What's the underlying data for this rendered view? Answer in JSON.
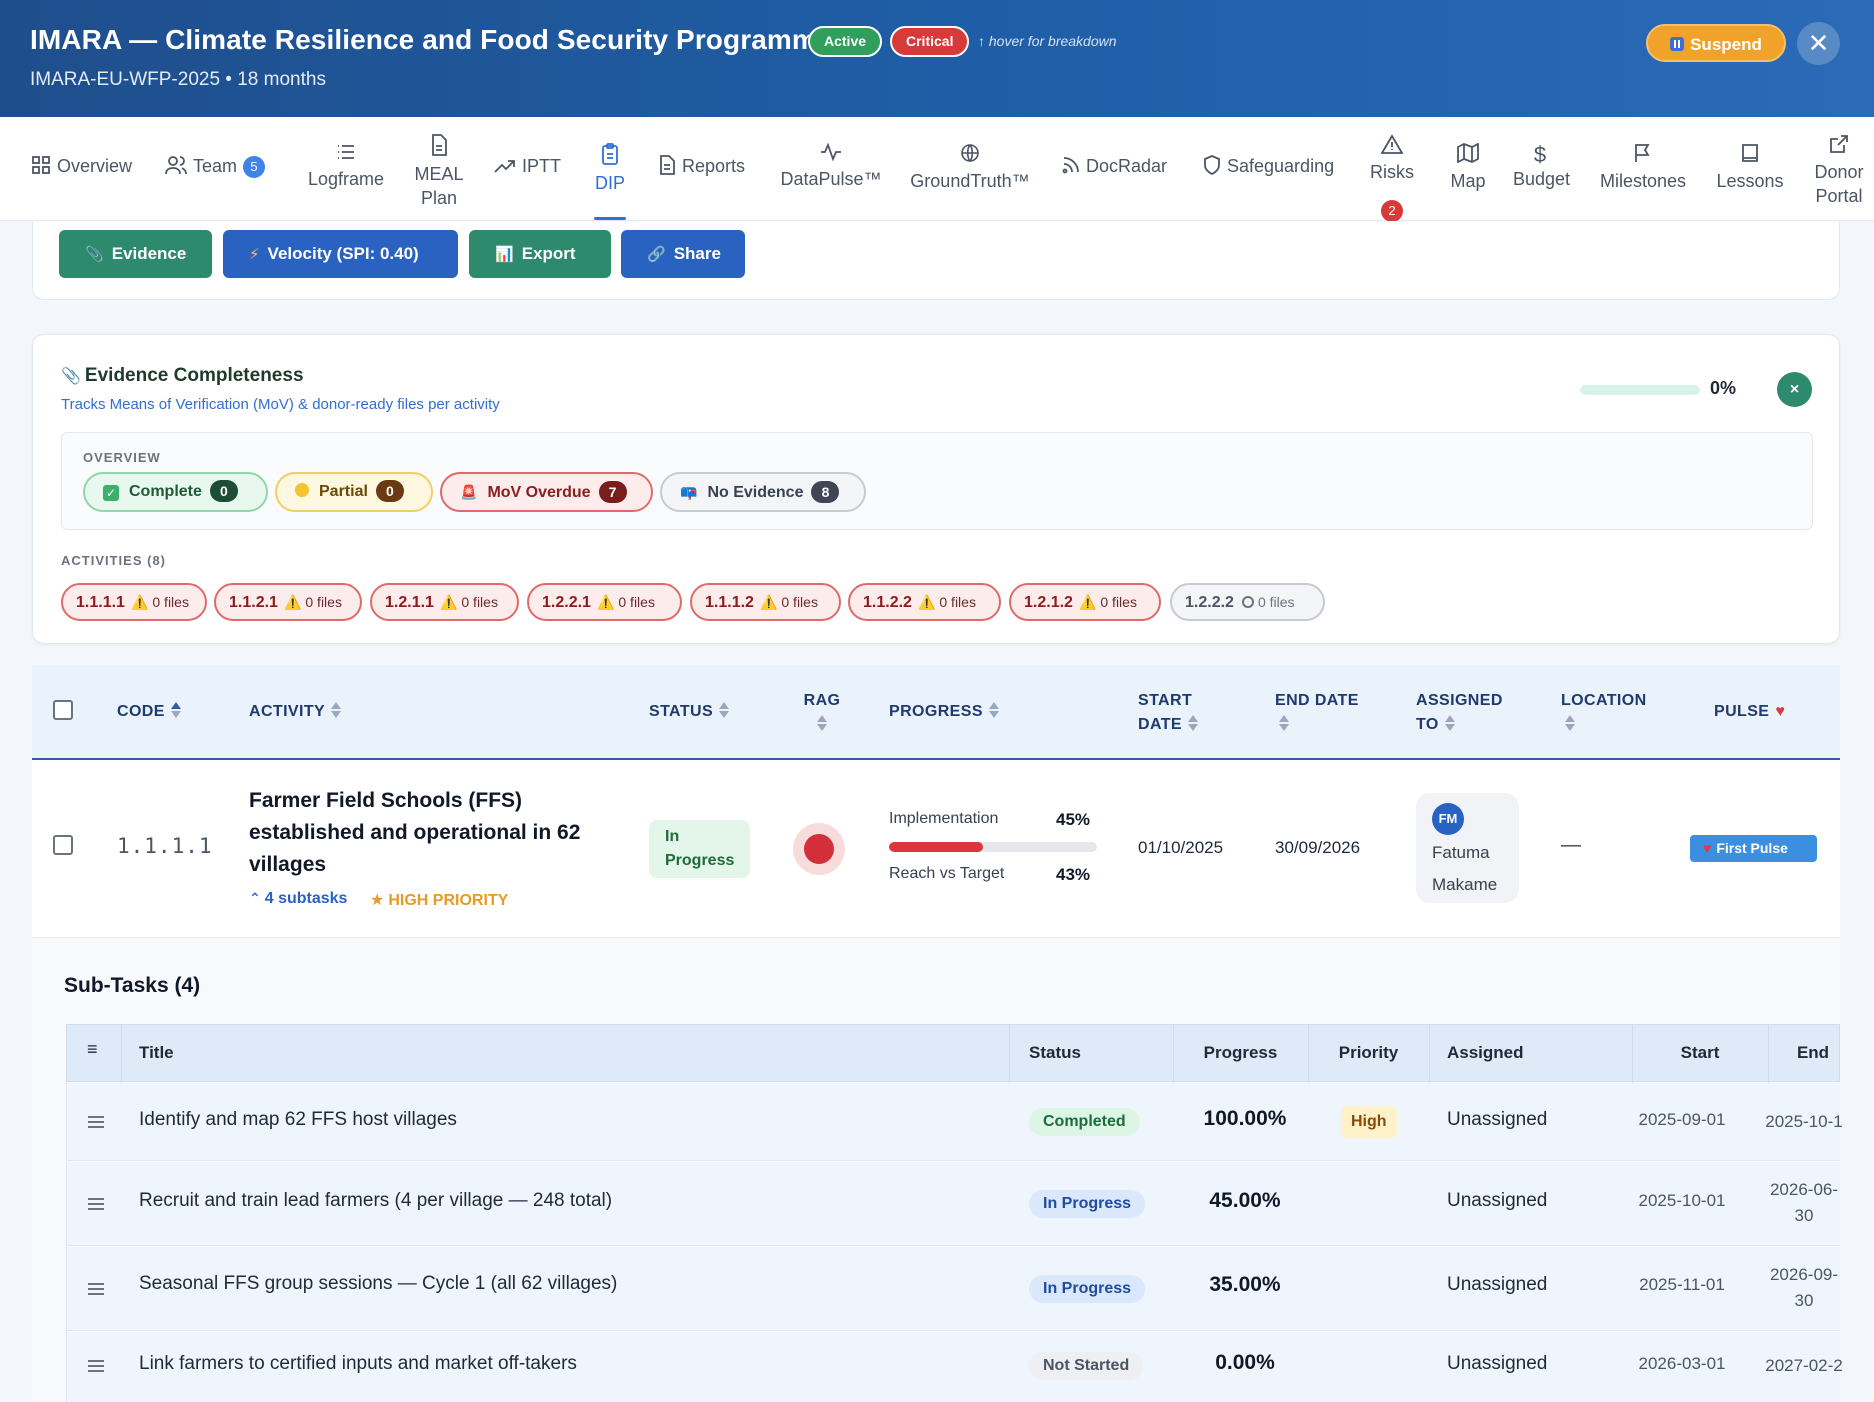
{
  "header": {
    "title": "IMARA — Climate Resilience and Food Security Programme",
    "subtitle": "IMARA-EU-WFP-2025 • 18 months",
    "status_active": "Active",
    "status_critical": "Critical",
    "hover_hint": "↑ hover for breakdown",
    "suspend_label": "Suspend",
    "close_symbol": "✕"
  },
  "nav": {
    "overview": "Overview",
    "team": "Team",
    "team_count": "5",
    "logframe": "Logframe",
    "meal_line1": "MEAL",
    "meal_line2": "Plan",
    "iptt": "IPTT",
    "dip": "DIP",
    "reports": "Reports",
    "datapulse": "DataPulse™",
    "groundtruth": "GroundTruth™",
    "docradar": "DocRadar",
    "safeguarding": "Safeguarding",
    "risks": "Risks",
    "risks_count": "2",
    "map": "Map",
    "budget": "Budget",
    "milestones": "Milestones",
    "lessons": "Lessons",
    "donor_line1": "Donor",
    "donor_line2": "Portal"
  },
  "actions": {
    "evidence": "Evidence",
    "velocity": "Velocity  (SPI: 0.40)",
    "export": "Export",
    "share": "Share"
  },
  "evidence": {
    "title": "Evidence Completeness",
    "subtitle": "Tracks Means of Verification (MoV) & donor-ready files per activity",
    "completeness_fraction": 0,
    "percent_label": "0%",
    "close_symbol": "×",
    "overview_label": "OVERVIEW",
    "complete_label": "Complete",
    "complete_count": "0",
    "partial_label": "Partial",
    "partial_count": "0",
    "overdue_label": "MoV Overdue",
    "overdue_count": "7",
    "none_label": "No Evidence",
    "none_count": "8",
    "activities_label": "ACTIVITIES (8)",
    "activities": [
      {
        "code": "1.1.1.1",
        "files": "0 files"
      },
      {
        "code": "1.1.2.1",
        "files": "0 files"
      },
      {
        "code": "1.2.1.1",
        "files": "0 files"
      },
      {
        "code": "1.2.2.1",
        "files": "0 files"
      },
      {
        "code": "1.1.1.2",
        "files": "0 files"
      },
      {
        "code": "1.1.2.2",
        "files": "0 files"
      },
      {
        "code": "1.2.1.2",
        "files": "0 files"
      },
      {
        "code": "1.2.2.2",
        "files": "0 files"
      }
    ]
  },
  "table": {
    "col_code": "CODE",
    "col_activity": "ACTIVITY",
    "col_status": "STATUS",
    "col_rag": "RAG",
    "col_progress": "PROGRESS",
    "col_start_1": "START",
    "col_start_2": "DATE",
    "col_end": "END DATE",
    "col_assigned_1": "ASSIGNED",
    "col_assigned_2": "TO",
    "col_location": "LOCATION",
    "col_pulse": "PULSE",
    "row": {
      "code": "1.1.1.1",
      "title": "Farmer Field Schools (FFS) established and operational in 62 villages",
      "subtasks_link": "4 subtasks",
      "priority": "HIGH PRIORITY",
      "status": "In Progress",
      "rag_color": "#d32f3a",
      "implementation_label": "Implementation",
      "implementation_value": "45%",
      "implementation_fraction": 0.45,
      "reach_label": "Reach vs Target",
      "reach_value": "43%",
      "start_date": "01/10/2025",
      "end_date": "30/09/2026",
      "assignee_initials": "FM",
      "assignee_first": "Fatuma",
      "assignee_last": "Makame",
      "location": "—",
      "pulse_label": "First Pulse"
    }
  },
  "subtasks": {
    "heading": "Sub-Tasks (4)",
    "col_title": "Title",
    "col_status": "Status",
    "col_progress": "Progress",
    "col_priority": "Priority",
    "col_assigned": "Assigned",
    "col_start": "Start",
    "col_end": "End",
    "rows": [
      {
        "title": "Identify and map 62 FFS host villages",
        "status": "Completed",
        "progress": "100.00%",
        "priority": "High",
        "assigned": "Unassigned",
        "start": "2025-09-01",
        "end": "2025-10-1"
      },
      {
        "title": "Recruit and train lead farmers (4 per village — 248 total)",
        "status": "In Progress",
        "progress": "45.00%",
        "priority": "",
        "assigned": "Unassigned",
        "start": "2025-10-01",
        "end_1": "2026-06-",
        "end_2": "30"
      },
      {
        "title": "Seasonal FFS group sessions — Cycle 1 (all 62 villages)",
        "status": "In Progress",
        "progress": "35.00%",
        "priority": "",
        "assigned": "Unassigned",
        "start": "2025-11-01",
        "end_1": "2026-09-",
        "end_2": "30"
      },
      {
        "title": "Link farmers to certified inputs and market off-takers",
        "status": "Not Started",
        "progress": "0.00%",
        "priority": "",
        "assigned": "Unassigned",
        "start": "2026-03-01",
        "end": "2027-02-2"
      }
    ]
  }
}
